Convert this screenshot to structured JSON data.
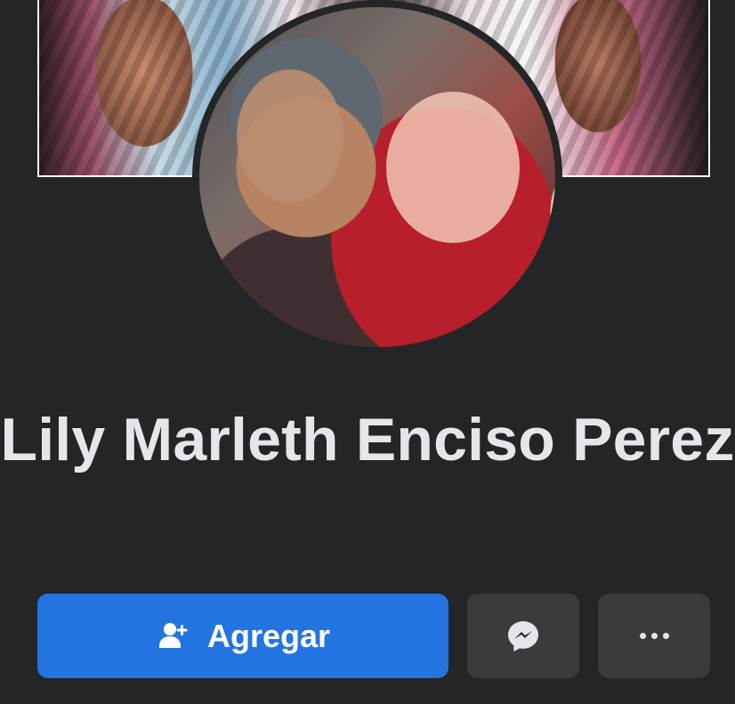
{
  "profile": {
    "name": "Lily Marleth Enciso Perez"
  },
  "actions": {
    "add_label": "Agregar"
  },
  "icons": {
    "add_friend": "add-friend-icon",
    "messenger": "messenger-icon",
    "more": "more-icon"
  },
  "colors": {
    "background": "#242526",
    "primary": "#2374e1",
    "secondary_button": "#3a3b3c",
    "text": "#e4e6eb"
  }
}
